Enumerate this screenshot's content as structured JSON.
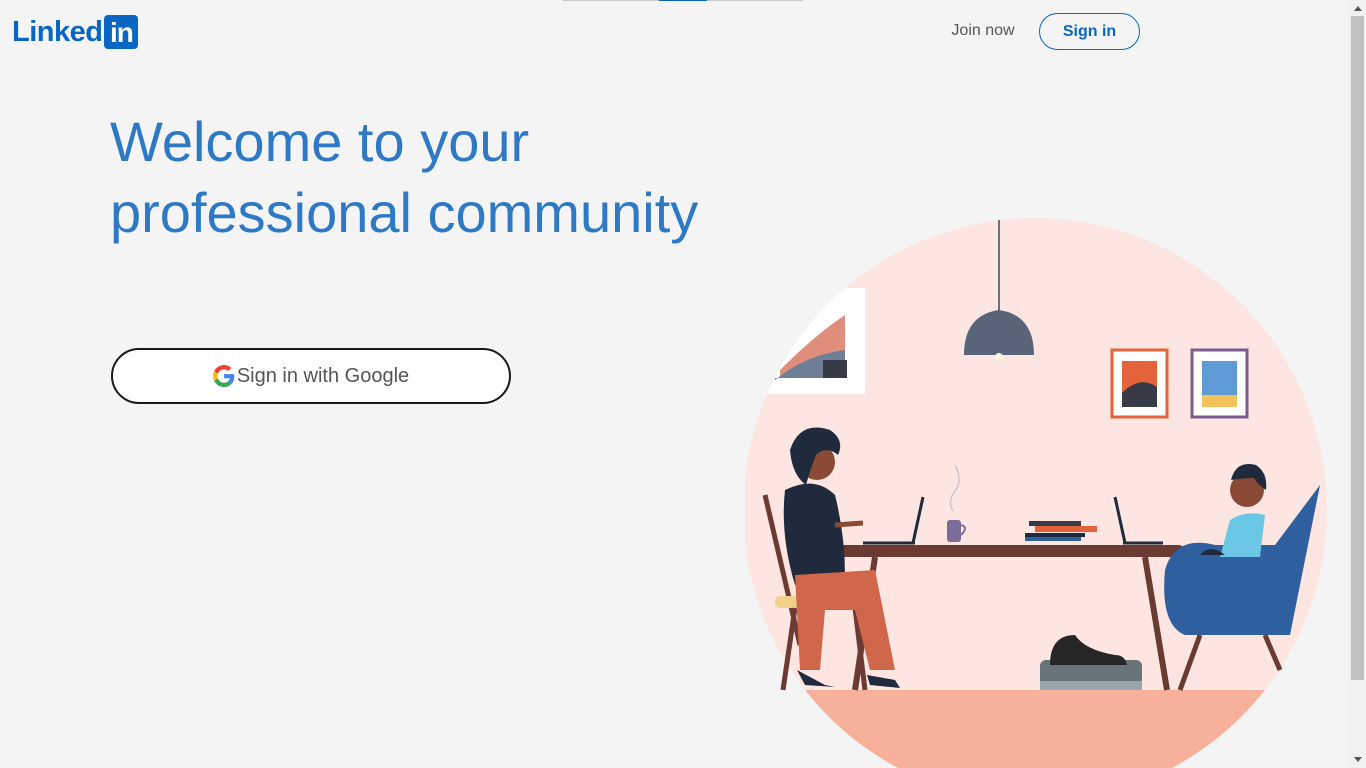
{
  "header": {
    "logo": {
      "word": "Linked",
      "box": "in"
    },
    "join_now": "Join now",
    "sign_in": "Sign in"
  },
  "hero": {
    "headline_line1": "Welcome to your",
    "headline_line2": "professional community",
    "google_button": "Sign in with Google"
  },
  "colors": {
    "brand": "#0a66c2",
    "headline": "#2e79c6",
    "background": "#f4f4f4"
  },
  "icons": [
    "google-icon"
  ]
}
